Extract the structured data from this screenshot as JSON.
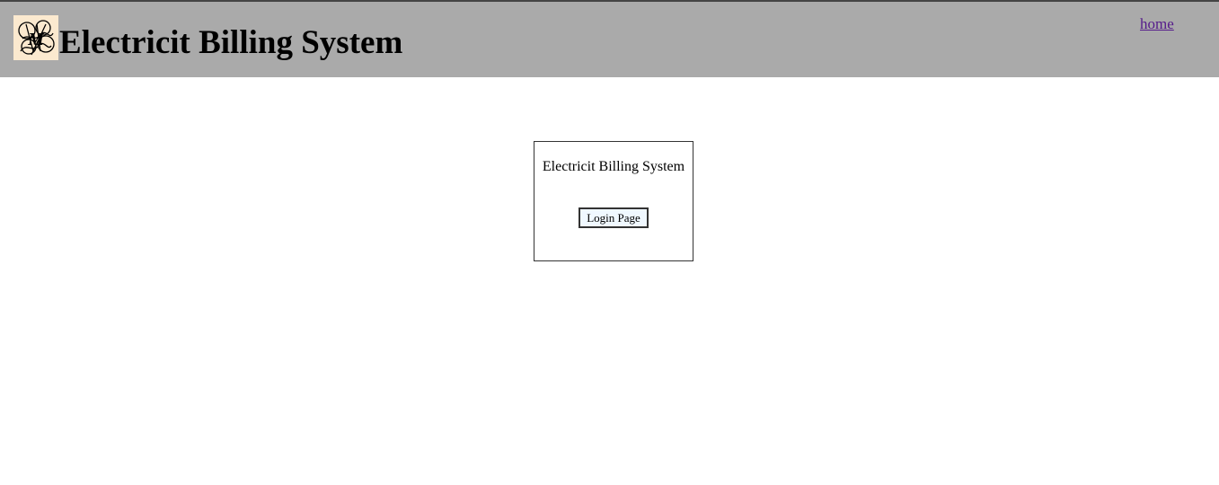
{
  "header": {
    "logo_icon": "ornamental-monogram-logo",
    "title": "Electricit Billing System",
    "home_link": "home",
    "background_color": "#aaaaaa"
  },
  "login_box": {
    "title": "Electricit Billing System",
    "button_label": "Login Page"
  }
}
